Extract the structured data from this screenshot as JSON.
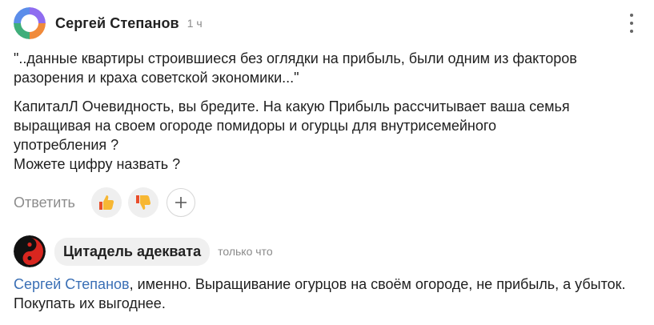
{
  "comments": [
    {
      "author": "Сергей Степанов",
      "time": "1 ч",
      "quote": "\"..данные квартиры строившиеся без оглядки на прибыль, были одним из факторов разорения и краха советской экономики...\"",
      "lines": [
        "КапиталЛ Очевидность, вы бредите. На какую Прибыль рассчитывает ваша семья выращивая на своем огороде помидоры и огурцы для внутрисемейного употребления ?",
        "Можете цифру назвать ?"
      ],
      "actions": {
        "reply_label": "Ответить",
        "like_icon": "thumbs-up-icon",
        "dislike_icon": "thumbs-down-icon",
        "add_icon": "plus-icon"
      }
    },
    {
      "author": "Цитадель адеквата",
      "time": "только что",
      "mention": "Сергей Степанов",
      "text": ", именно. Выращивание огурцов на своём огороде, не прибыль, а убыток. Покупать их выгоднее."
    }
  ],
  "colors": {
    "mention": "#3a6fb5",
    "muted": "#8c8c8c",
    "pill": "#f0f0f0"
  }
}
